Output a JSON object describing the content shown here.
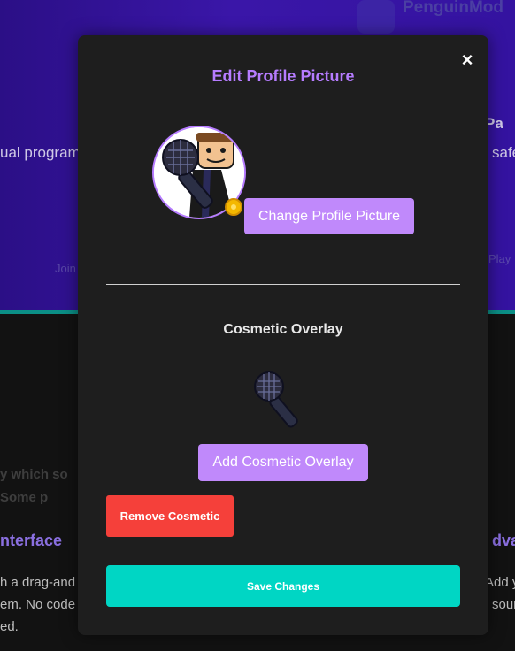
{
  "background": {
    "brand_name": "PenguinMod",
    "hero_left_text": "ual program",
    "hero_right_text": "safe",
    "hero_right_fragment": "Pa",
    "hero_faded_left": "Join",
    "hero_faded_right": "Play",
    "muted_line_1": "y which so",
    "muted_line_2": "Some p",
    "feature_left_title": "nterface",
    "feature_left_text_1": "h a drag-and",
    "feature_left_text_2": "em. No code",
    "feature_left_text_3": "ed.",
    "feature_right_title": "dva",
    "feature_right_text_1": "Add y",
    "feature_right_text_2": "soun"
  },
  "modal": {
    "title": "Edit Profile Picture",
    "close_label": "×",
    "change_picture_label": "Change Profile Picture",
    "cosmetic_section_title": "Cosmetic Overlay",
    "add_cosmetic_label": "Add Cosmetic Overlay",
    "remove_cosmetic_label": "Remove Cosmetic",
    "save_label": "Save Changes"
  },
  "colors": {
    "accent_purple": "#c089fb",
    "title_purple": "#b67cff",
    "danger_red": "#f5403a",
    "save_teal": "#00d6c4",
    "modal_bg": "#1e1e1e"
  },
  "icons": {
    "close": "close-icon",
    "avatar_overlay": "microphone-icon",
    "badge": "gold-badge-icon",
    "cosmetic_preview": "microphone-icon"
  }
}
